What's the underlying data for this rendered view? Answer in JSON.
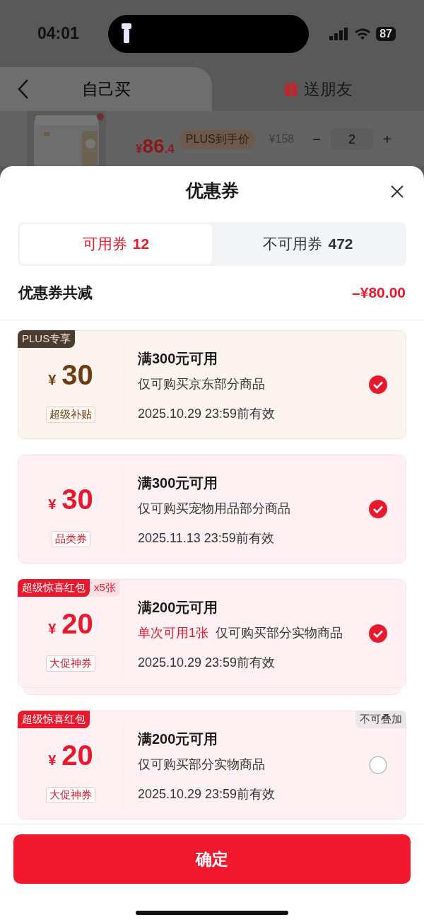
{
  "status_bar": {
    "time": "04:01",
    "battery": "87"
  },
  "header": {
    "tabs": [
      {
        "label": "自己买",
        "kind": "plain",
        "selected": true
      },
      {
        "label": "送朋友",
        "kind": "gift",
        "selected": false
      }
    ]
  },
  "product": {
    "currency": "¥",
    "price_int": "86",
    "price_dec": ".4",
    "price_tag": "PLUS到手价",
    "original_price": "¥158",
    "minus": "−",
    "quantity": "2",
    "plus": "+"
  },
  "sheet": {
    "title": "优惠券",
    "tabs": [
      {
        "label": "可用券",
        "count": "12",
        "selected": true
      },
      {
        "label": "不可用券",
        "count": "472",
        "selected": false
      }
    ],
    "total_label": "优惠券共减",
    "total_value": "–¥80.00"
  },
  "coupons": [
    {
      "kind": "plus",
      "badge": "PLUS专享",
      "currency": "¥",
      "amount": "30",
      "tag": "超级补贴",
      "title": "满300元可用",
      "desc": "仅可购买京东部分商品",
      "expiry": "2025.10.29 23:59前有效",
      "selected": true,
      "stacked": false
    },
    {
      "kind": "red",
      "currency": "¥",
      "amount": "30",
      "tag": "品类券",
      "title": "满300元可用",
      "desc": "仅可购买宠物用品部分商品",
      "expiry": "2025.11.13 23:59前有效",
      "selected": true,
      "stacked": false
    },
    {
      "kind": "red",
      "badge": "超级惊喜红包",
      "count_badge": "x5张",
      "currency": "¥",
      "amount": "20",
      "tag": "大促神券",
      "title": "满200元可用",
      "restriction": "单次可用1张",
      "desc": "仅可购买部分实物商品",
      "expiry": "2025.10.29 23:59前有效",
      "selected": true,
      "stacked": true
    },
    {
      "kind": "red",
      "badge": "超级惊喜红包",
      "corner_label": "不可叠加",
      "currency": "¥",
      "amount": "20",
      "tag": "大促神券",
      "title": "满200元可用",
      "desc": "仅可购买部分实物商品",
      "expiry": "2025.10.29 23:59前有效",
      "selected": false,
      "stacked": false
    }
  ],
  "confirm_button": "确定"
}
